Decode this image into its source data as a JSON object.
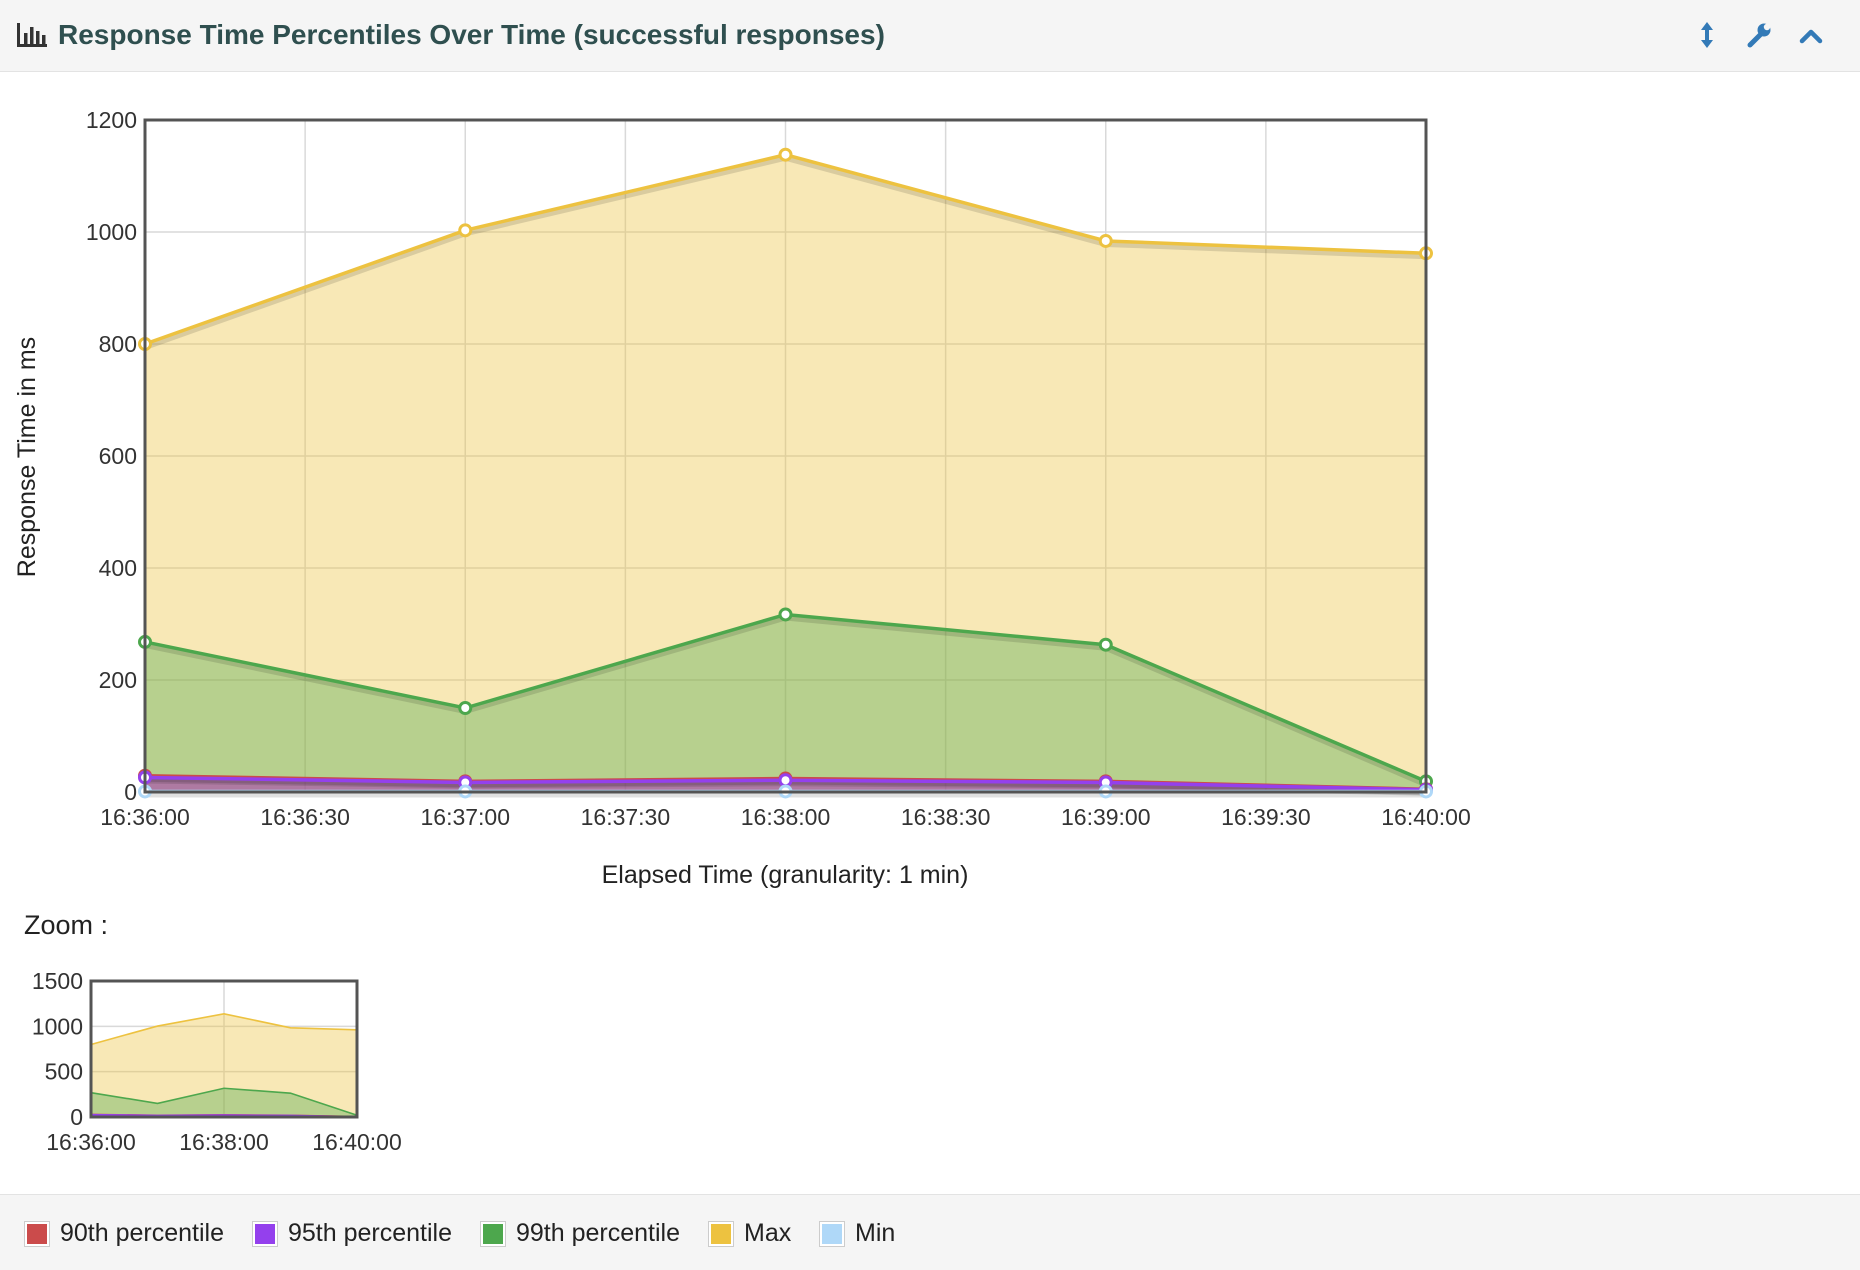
{
  "header": {
    "title": "Response Time Percentiles Over Time (successful responses)",
    "icon": "bar-chart-icon",
    "buttons": [
      {
        "name": "resize-button",
        "icon": "vertical-arrows-icon"
      },
      {
        "name": "settings-button",
        "icon": "wrench-icon"
      },
      {
        "name": "collapse-button",
        "icon": "chevron-up-icon"
      }
    ],
    "accent_color": "#337ab7"
  },
  "chart_data": {
    "type": "area",
    "title": "",
    "xlabel": "Elapsed Time (granularity: 1 min)",
    "ylabel": "Response Time in ms",
    "x": [
      "16:36:00",
      "16:37:00",
      "16:38:00",
      "16:39:00",
      "16:40:00"
    ],
    "x_ticks": [
      "16:36:00",
      "16:36:30",
      "16:37:00",
      "16:37:30",
      "16:38:00",
      "16:38:30",
      "16:39:00",
      "16:39:30",
      "16:40:00"
    ],
    "y_ticks": [
      0,
      200,
      400,
      600,
      800,
      1000,
      1200
    ],
    "ylim": [
      0,
      1200
    ],
    "grid": true,
    "series": [
      {
        "name": "Max",
        "color": "#edc240",
        "values": [
          800,
          1003,
          1138,
          984,
          962
        ]
      },
      {
        "name": "99th percentile",
        "color": "#4da74d",
        "values": [
          268,
          150,
          317,
          263,
          19
        ]
      },
      {
        "name": "90th percentile",
        "color": "#cb4b4b",
        "values": [
          29,
          19,
          24,
          19,
          5
        ]
      },
      {
        "name": "95th percentile",
        "color": "#9440ed",
        "values": [
          26,
          17,
          21,
          17,
          4
        ]
      },
      {
        "name": "Min",
        "color": "#afd8f8",
        "values": [
          1,
          1,
          1,
          1,
          1
        ]
      }
    ],
    "overview": {
      "label": "Zoom :",
      "y_ticks": [
        0,
        500,
        1000,
        1500
      ],
      "ylim": [
        0,
        1500
      ],
      "x_ticks": [
        "16:36:00",
        "16:38:00",
        "16:40:00"
      ]
    },
    "legend": {
      "placement": "bottom",
      "items": [
        {
          "label": "90th percentile",
          "color": "#cb4b4b"
        },
        {
          "label": "95th percentile",
          "color": "#9440ed"
        },
        {
          "label": "99th percentile",
          "color": "#4da74d"
        },
        {
          "label": "Max",
          "color": "#edc240"
        },
        {
          "label": "Min",
          "color": "#afd8f8"
        }
      ]
    }
  }
}
